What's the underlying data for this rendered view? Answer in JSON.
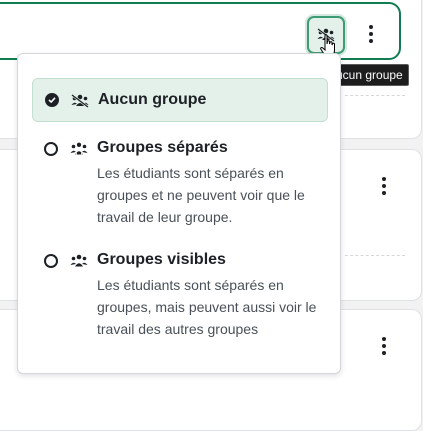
{
  "group_button": {
    "icon": "group-none-icon"
  },
  "tooltip": "Aucun groupe",
  "menu": {
    "options": [
      {
        "label": "Aucun groupe",
        "description": "",
        "icon": "group-none-icon",
        "selected": true
      },
      {
        "label": "Groupes séparés",
        "description": "Les étudiants sont séparés en groupes et ne peuvent voir que le travail de leur groupe.",
        "icon": "group-separate-icon",
        "selected": false
      },
      {
        "label": "Groupes visibles",
        "description": "Les étudiants sont séparés en groupes, mais peuvent aussi voir le travail des autres groupes",
        "icon": "group-visible-icon",
        "selected": false
      }
    ]
  },
  "colors": {
    "accent": "#0f7d51",
    "selected_bg": "#e4f1ea"
  }
}
